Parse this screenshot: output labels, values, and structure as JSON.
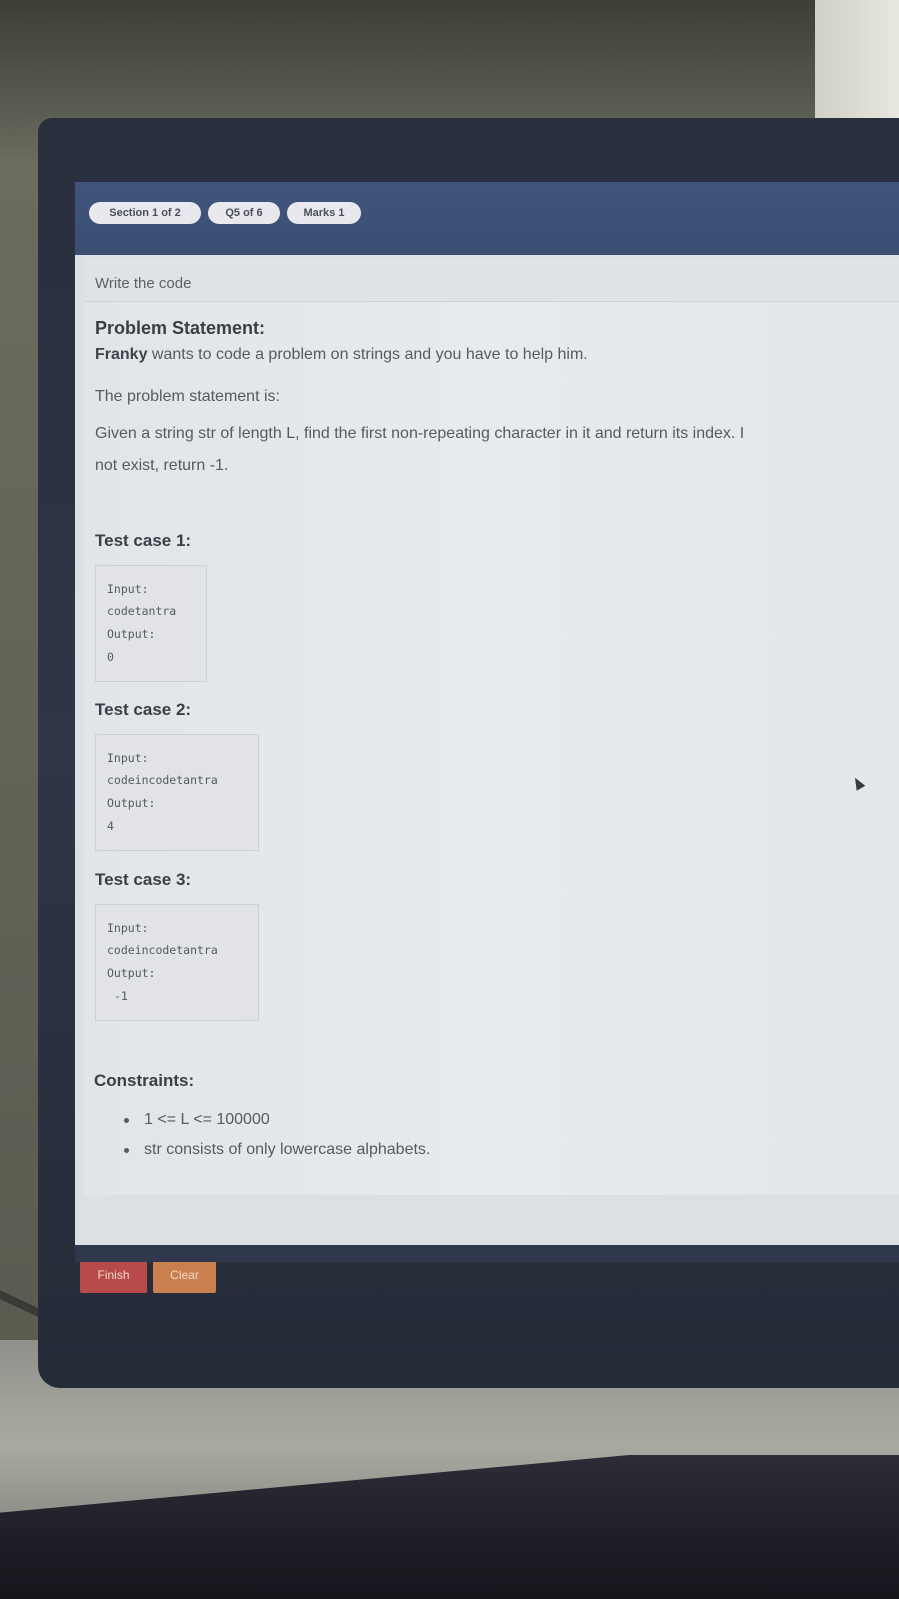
{
  "header": {
    "section": "Section 1 of 2",
    "question": "Q5 of 6",
    "marks": "Marks 1"
  },
  "panel_title": "Write the code",
  "problem": {
    "heading": "Problem Statement:",
    "intro_name": "Franky",
    "intro_rest": " wants to code a problem on strings and you have to help him.",
    "statement_label": "The problem statement is:",
    "statement_line1": "Given a string str of length L, find the first non-repeating character in it and return its index. I",
    "statement_line2": "not exist, return  -1."
  },
  "test_cases": [
    {
      "title": "Test case 1:",
      "input_label": "Input:",
      "input": "codetantra",
      "output_label": "Output:",
      "output": "0"
    },
    {
      "title": "Test case 2:",
      "input_label": "Input:",
      "input": "codeincodetantra",
      "output_label": "Output:",
      "output": "4"
    },
    {
      "title": "Test case 3:",
      "input_label": "Input:",
      "input": "codeincodetantra",
      "output_label": "Output:",
      "output": "-1"
    }
  ],
  "constraints": {
    "heading": "Constraints:",
    "items": [
      "1 <= L <= 100000",
      "str consists of only lowercase alphabets."
    ]
  },
  "buttons": {
    "finish": "Finish",
    "clear": "Clear"
  },
  "colors": {
    "topbar": "#3b4f74",
    "finish": "#b84a4a",
    "clear": "#c9804e"
  }
}
